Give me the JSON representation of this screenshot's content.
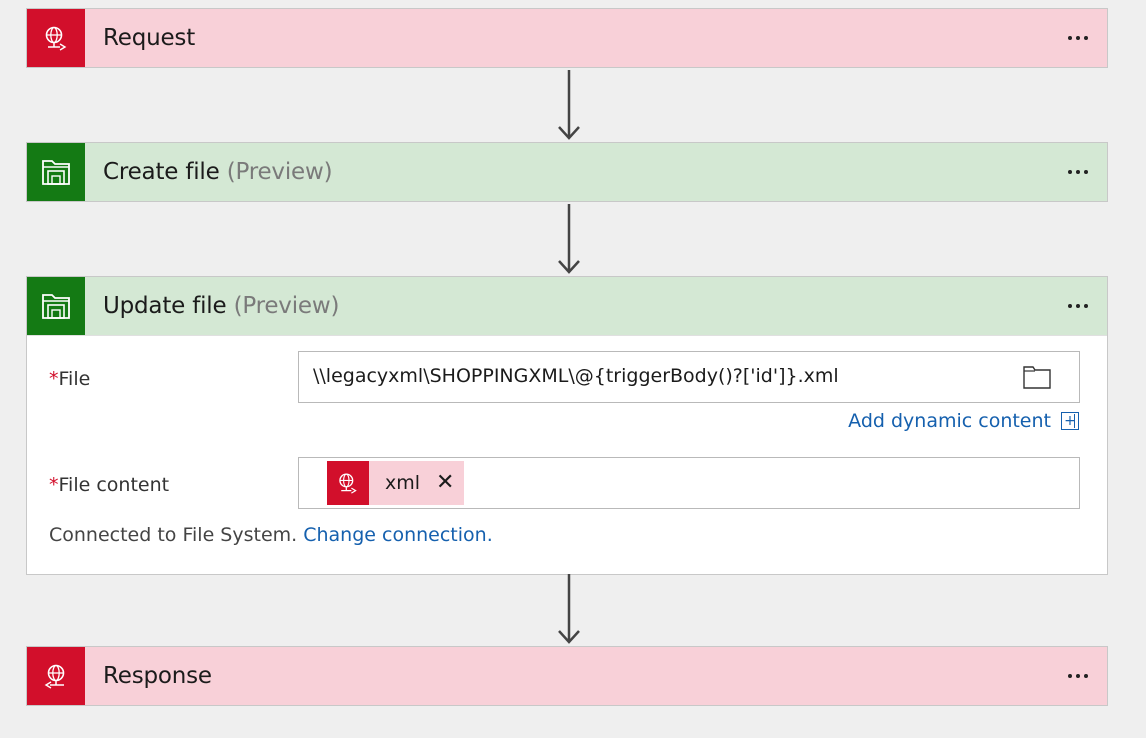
{
  "steps": [
    {
      "title": "Request",
      "icon": "request-globe-icon",
      "theme": "red"
    },
    {
      "title": "Create file",
      "suffix": "(Preview)",
      "icon": "file-system-icon",
      "theme": "green"
    },
    {
      "title": "Update file",
      "suffix": "(Preview)",
      "icon": "file-system-icon",
      "theme": "green"
    },
    {
      "title": "Response",
      "icon": "response-globe-icon",
      "theme": "red"
    }
  ],
  "update_file": {
    "file_label": "File",
    "file_required_marker": "*",
    "file_value": "\\\\legacyxml\\SHOPPINGXML\\@{triggerBody()?['id']}.xml",
    "add_dynamic_label": "Add dynamic content",
    "content_label": "File content",
    "content_required_marker": "*",
    "token_label": "xml",
    "token_close": "✕",
    "connection_text": "Connected to File System.",
    "change_connection_label": "Change connection."
  },
  "colors": {
    "red_accent": "#d20f2b",
    "red_bg": "#f8d0d8",
    "green_accent": "#147a14",
    "green_bg": "#d4e8d4",
    "link": "#1560ae"
  }
}
